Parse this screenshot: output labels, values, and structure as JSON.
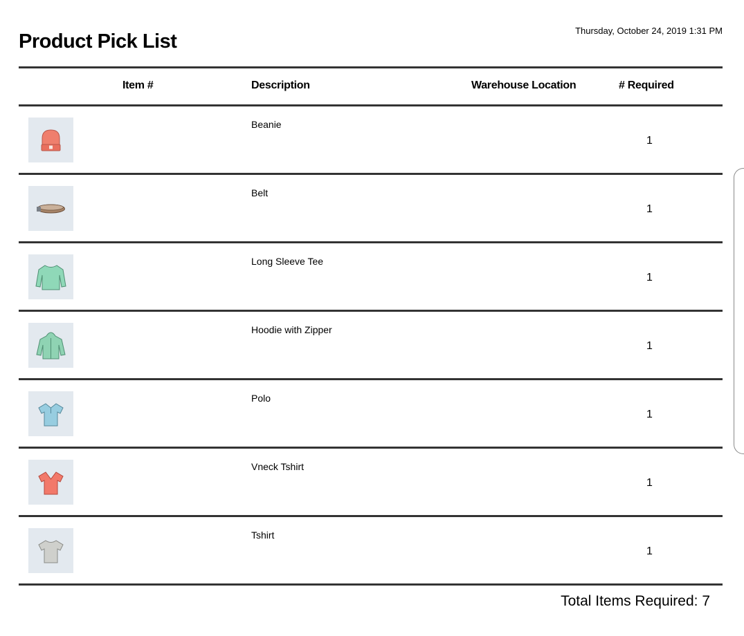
{
  "report": {
    "title": "Product Pick List",
    "timestamp": "Thursday, October 24, 2019 1:31 PM"
  },
  "table": {
    "columns": [
      "Item #",
      "Description",
      "Warehouse Location",
      "# Required"
    ],
    "rows": [
      {
        "description": "Beanie",
        "required": "1",
        "icon": "beanie-icon",
        "color": "#ef7f6d"
      },
      {
        "description": "Belt",
        "required": "1",
        "icon": "belt-icon",
        "color": "#9c7d62"
      },
      {
        "description": "Long Sleeve Tee",
        "required": "1",
        "icon": "long-sleeve-tee-icon",
        "color": "#8fd8b8"
      },
      {
        "description": "Hoodie with Zipper",
        "required": "1",
        "icon": "hoodie-icon",
        "color": "#8fd3b3"
      },
      {
        "description": "Polo",
        "required": "1",
        "icon": "polo-icon",
        "color": "#97cde0"
      },
      {
        "description": "Vneck Tshirt",
        "required": "1",
        "icon": "vneck-tshirt-icon",
        "color": "#f2796a"
      },
      {
        "description": "Tshirt",
        "required": "1",
        "icon": "tshirt-icon",
        "color": "#cfd0cc"
      }
    ]
  },
  "total": {
    "text": "Total Items Required: 7"
  }
}
